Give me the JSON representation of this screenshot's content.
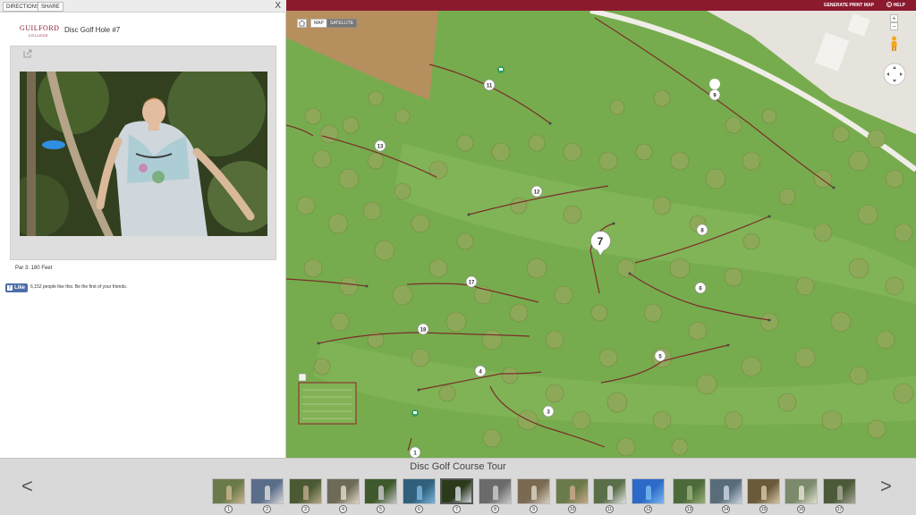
{
  "toolbar": {
    "directions_label": "DIRECTIONS",
    "share_label": "SHARE",
    "close_label": "X"
  },
  "header": {
    "logo_name": "GUILFORD",
    "logo_sub": "COLLEGE",
    "title": "Disc Golf Hole #7"
  },
  "details": {
    "par_text": "Par 3: 180 Feet",
    "like_label": "Like",
    "like_count_text": "6,152 people like this. Be the first of your friends."
  },
  "map": {
    "print_label": "GENERATE PRINT MAP",
    "help_label": "HELP",
    "map_label": "MAP",
    "satellite_label": "SATELLITE",
    "zoom_in": "+",
    "zoom_out": "−",
    "selected_marker": "7",
    "markers": [
      {
        "number": "9"
      },
      {
        "number": "11"
      },
      {
        "number": "13"
      },
      {
        "number": "12"
      },
      {
        "number": "8"
      },
      {
        "number": "7"
      },
      {
        "number": "17"
      },
      {
        "number": "6"
      },
      {
        "number": "18"
      },
      {
        "number": "5"
      },
      {
        "number": "4"
      },
      {
        "number": "3"
      },
      {
        "number": "1"
      }
    ],
    "colors": {
      "brand": "#8b1a2f",
      "grass": "#77ad4e",
      "trees": "#8aa356",
      "fairway": "#7b2e2a"
    }
  },
  "tour": {
    "title": "Disc Golf Course Tour",
    "prev_label": "<",
    "next_label": ">",
    "active_hole": "7",
    "thumbs": [
      {
        "label": "1"
      },
      {
        "label": "2"
      },
      {
        "label": "3"
      },
      {
        "label": "4"
      },
      {
        "label": "5"
      },
      {
        "label": "6"
      },
      {
        "label": "7"
      },
      {
        "label": "8"
      },
      {
        "label": "9"
      },
      {
        "label": "10"
      },
      {
        "label": "11"
      },
      {
        "label": "12"
      },
      {
        "label": "13"
      },
      {
        "label": "14"
      },
      {
        "label": "15"
      },
      {
        "label": "16"
      },
      {
        "label": "17"
      }
    ]
  }
}
